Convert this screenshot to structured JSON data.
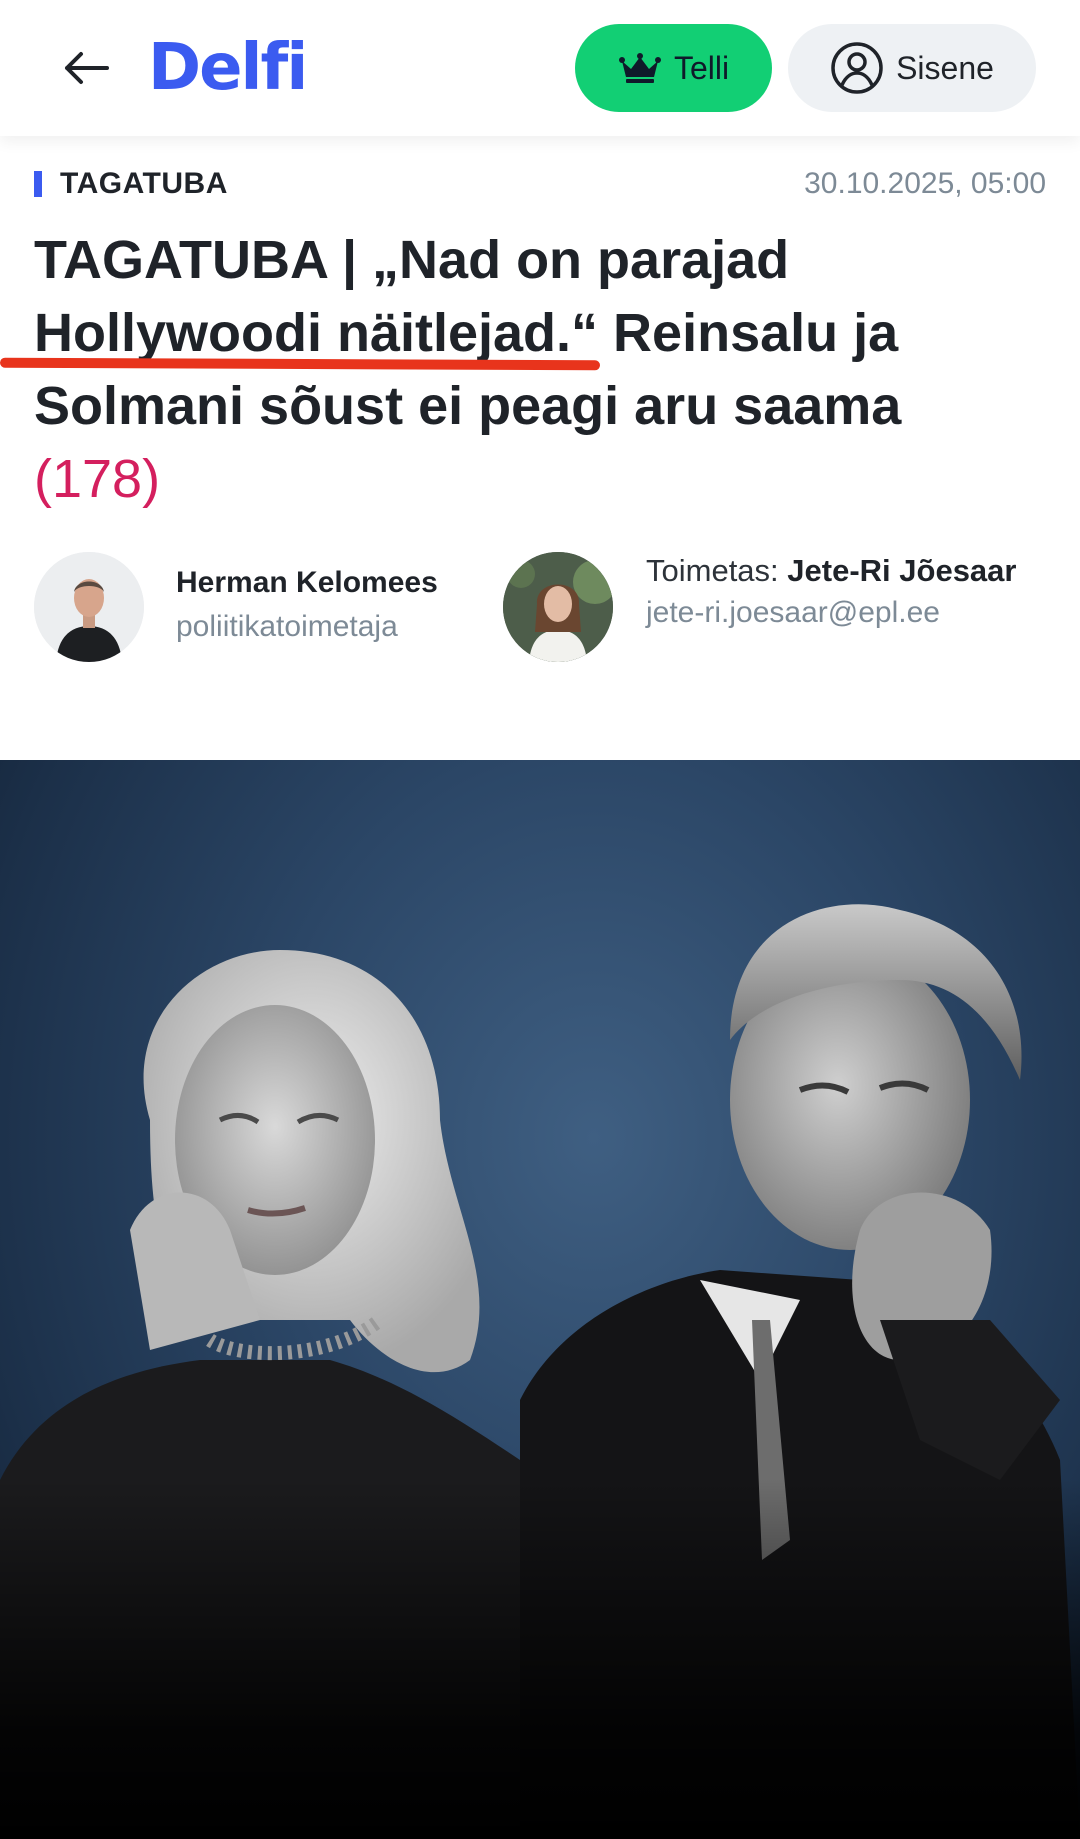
{
  "header": {
    "logo_text": "Delfi",
    "subscribe_label": "Telli",
    "login_label": "Sisene",
    "icons": {
      "back": "arrow-left-icon",
      "subscribe": "crown-icon",
      "login": "user-circle-icon"
    },
    "colors": {
      "brand": "#3b5bf0",
      "subscribe_bg": "#12cf74",
      "login_bg": "#eef1f4"
    }
  },
  "article": {
    "category": "TAGATUBA",
    "timestamp": "30.10.2025, 05:00",
    "headline": {
      "part1": "TAGATUBA | „Nad on parajad ",
      "highlight": "Hollywoodi näitlejad.",
      "part2": "“ Reinsalu ja Solmani sõust ei peagi aru saama",
      "comments": "(178)"
    },
    "comment_color": "#d41f5e",
    "underline_color": "#e8341c"
  },
  "authors": {
    "author": {
      "name": "Herman Kelomees",
      "role": "poliitikatoimetaja"
    },
    "editor": {
      "prefix": "Toimetas:",
      "name": "Jete-Ri Jõesaar",
      "email": "jete-ri.joesaar@epl.ee"
    }
  },
  "hero": {
    "background": "#2b4666"
  }
}
